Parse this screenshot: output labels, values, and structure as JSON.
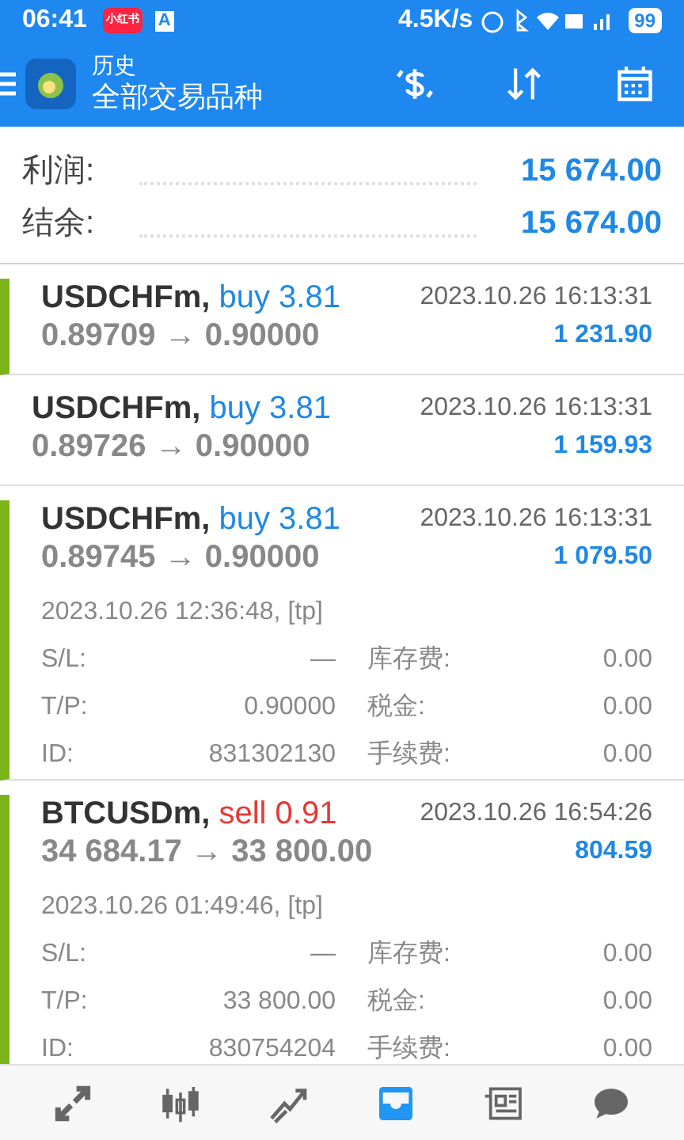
{
  "status_bar": {
    "time": "06:41",
    "app_badge": "小红书",
    "app_letter": "A",
    "speed": "4.5K/s",
    "battery": "99"
  },
  "header": {
    "title": "历史",
    "subtitle": "全部交易品种"
  },
  "summary": [
    {
      "label": "利润:",
      "value": "15 674.00"
    },
    {
      "label": "结余:",
      "value": "15 674.00"
    }
  ],
  "trades": [
    {
      "kind": "simple",
      "marker": true,
      "symbol": "USDCHFm,",
      "action": {
        "text": "buy 3.81",
        "color": "#1e88e5"
      },
      "prices": "0.89709 → 0.90000",
      "time": "2023.10.26 16:13:31",
      "profit": "1 231.90"
    },
    {
      "kind": "simple",
      "marker": false,
      "symbol": "USDCHFm,",
      "action": {
        "text": "buy 3.81",
        "color": "#1e88e5"
      },
      "prices": "0.89726 → 0.90000",
      "time": "2023.10.26 16:13:31",
      "profit": "1 159.93"
    },
    {
      "kind": "expanded",
      "marker": true,
      "symbol": "USDCHFm,",
      "action": {
        "text": "buy 3.81",
        "color": "#1e88e5"
      },
      "prices": "0.89745 → 0.90000",
      "time": "2023.10.26 16:13:31",
      "profit": "1 079.50",
      "open_info": "2023.10.26 12:36:48, [tp]",
      "details": [
        [
          "S/L:",
          "—",
          "库存费:",
          "0.00"
        ],
        [
          "T/P:",
          "0.90000",
          "税金:",
          "0.00"
        ],
        [
          "ID:",
          "831302130",
          "手续费:",
          "0.00"
        ]
      ]
    },
    {
      "kind": "expanded",
      "marker": true,
      "symbol": "BTCUSDm,",
      "action": {
        "text": "sell 0.91",
        "color": "#e53935"
      },
      "prices": "34 684.17 → 33 800.00",
      "time": "2023.10.26 16:54:26",
      "profit": "804.59",
      "open_info": "2023.10.26 01:49:46, [tp]",
      "details": [
        [
          "S/L:",
          "—",
          "库存费:",
          "0.00"
        ],
        [
          "T/P:",
          "33 800.00",
          "税金:",
          "0.00"
        ],
        [
          "ID:",
          "830754204",
          "手续费:",
          "0.00"
        ]
      ]
    }
  ],
  "nav": [
    {
      "selected": false
    },
    {
      "selected": false
    },
    {
      "selected": false
    },
    {
      "selected": true
    },
    {
      "selected": false
    },
    {
      "selected": false
    }
  ]
}
